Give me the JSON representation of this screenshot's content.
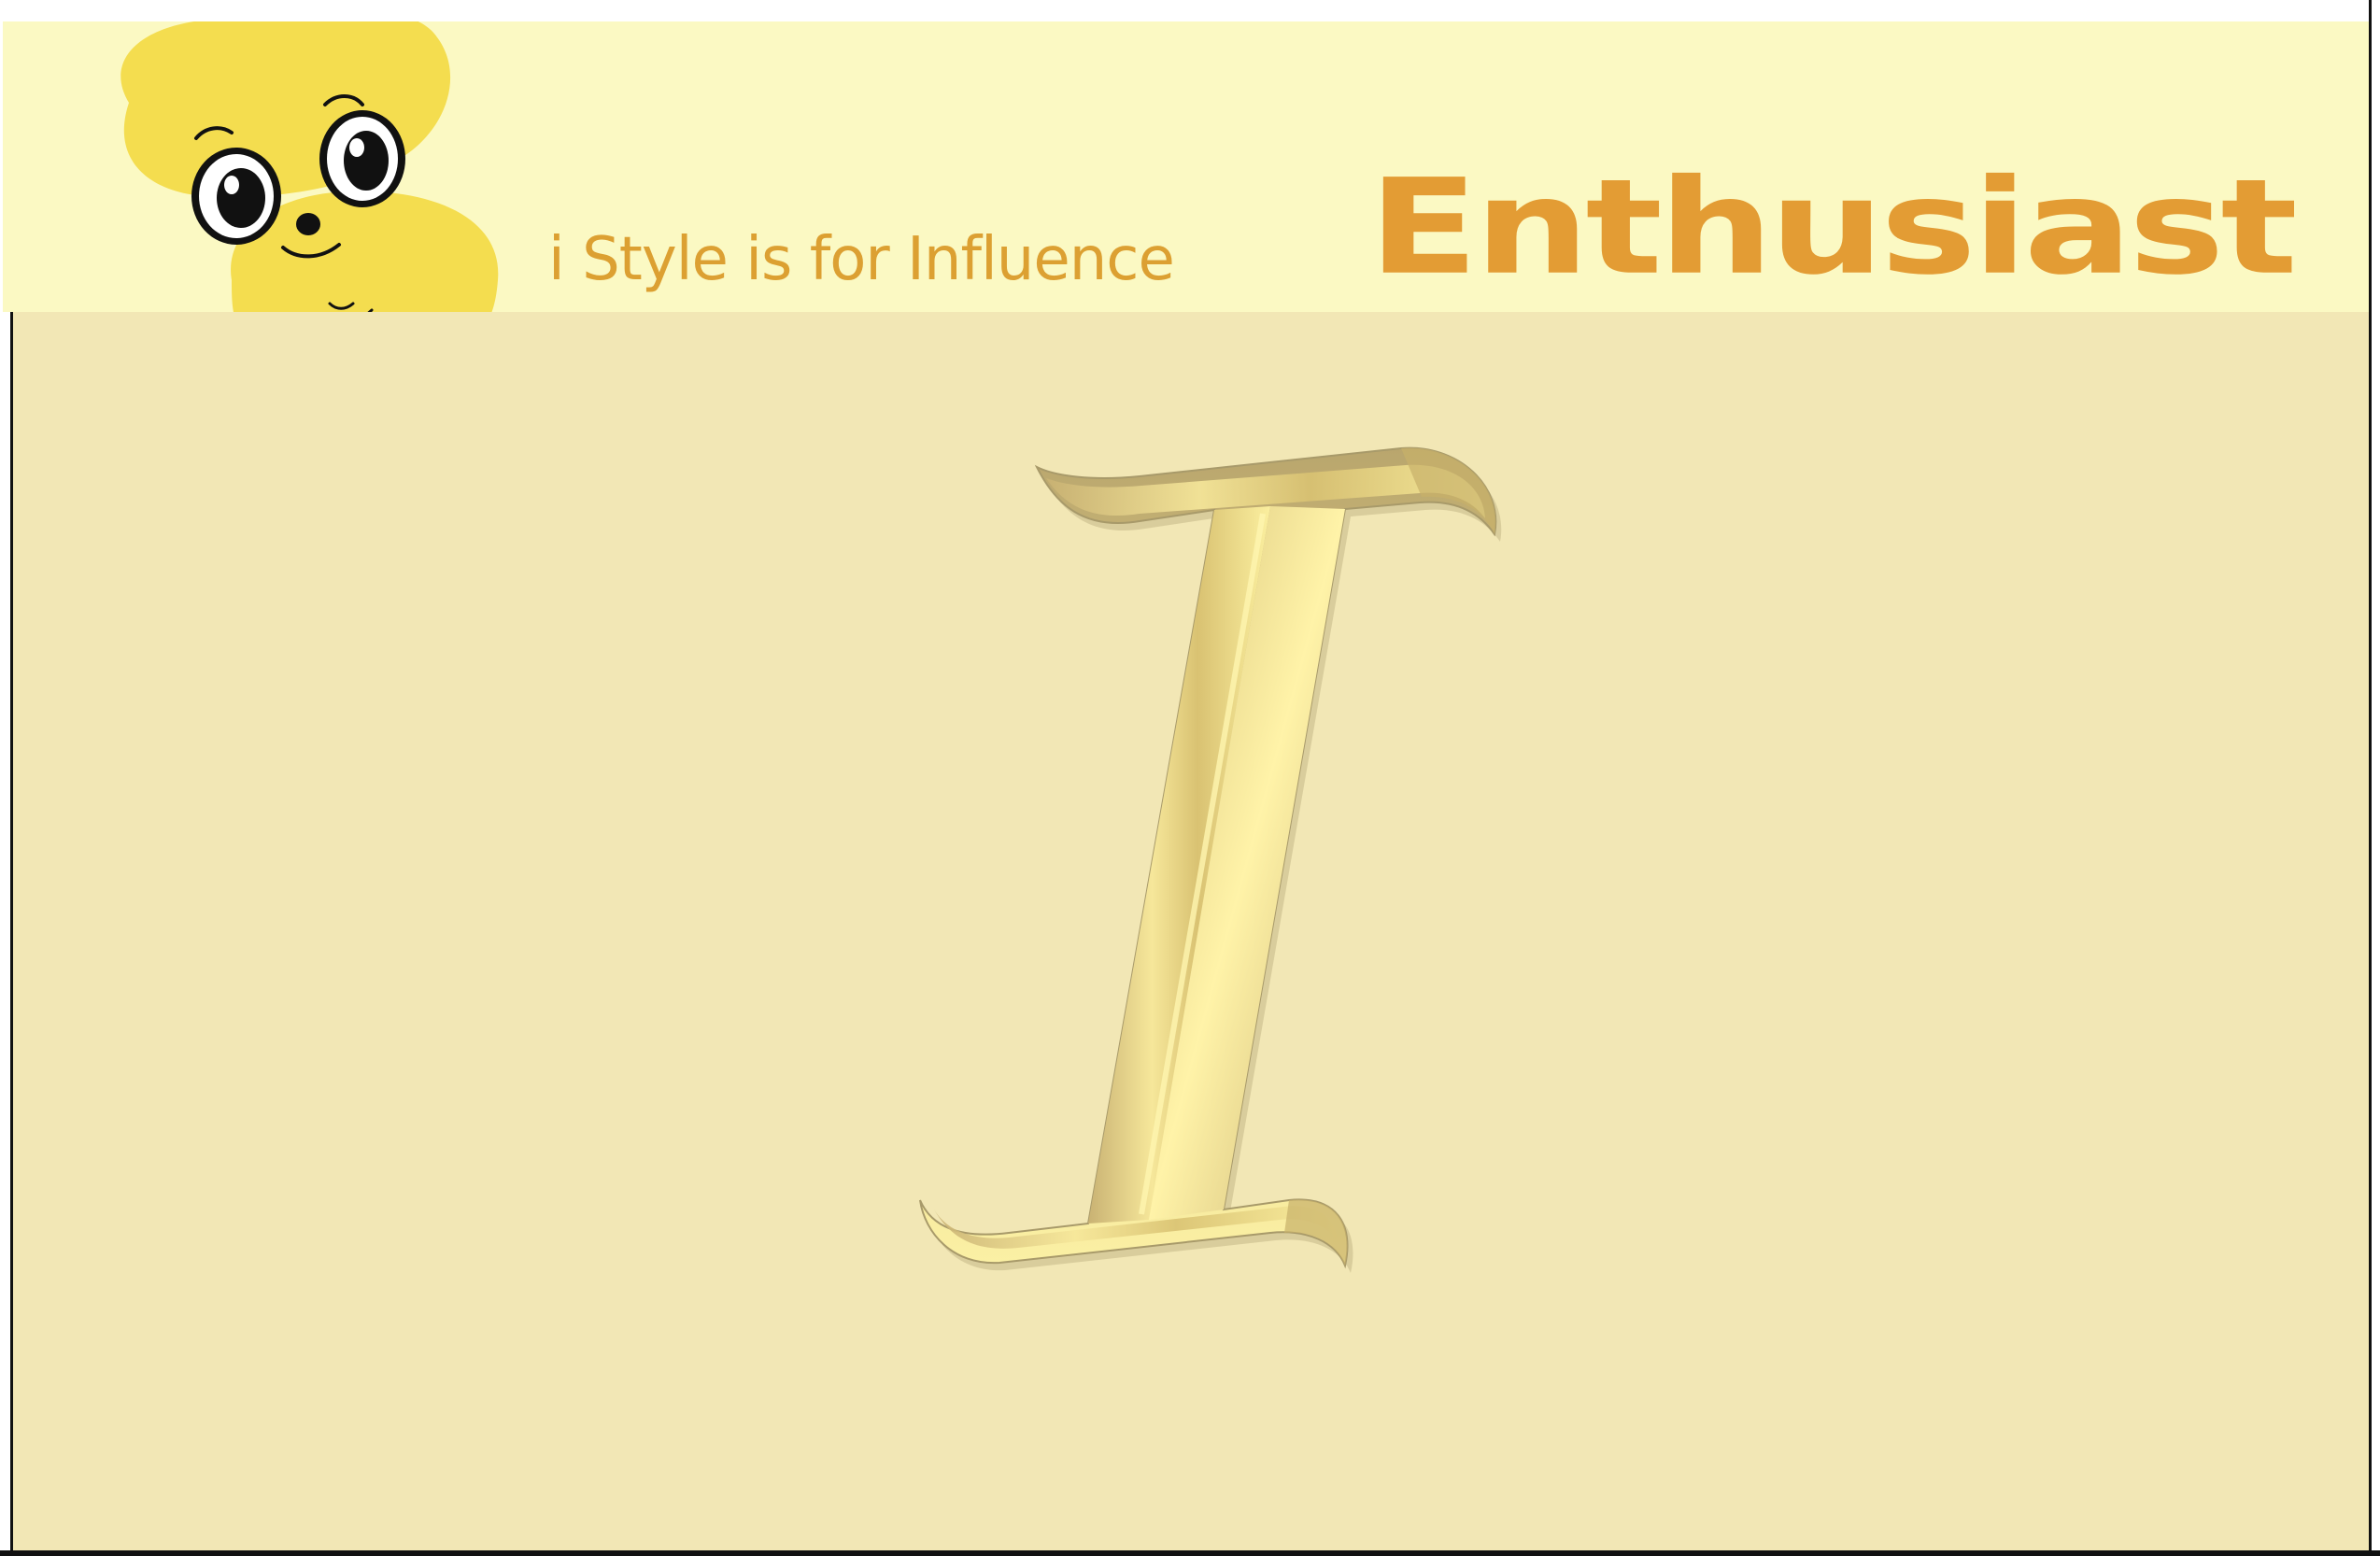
{
  "header": {
    "tagline": "i Style is for Influence",
    "brand": "Enthusiast"
  },
  "mascot": {
    "icon": "yellow-blob-mascot-icon"
  },
  "main": {
    "letter": "I",
    "letter_style": "embossed-gold-italic"
  },
  "colors": {
    "banner_bg": "#fbf9c3",
    "canvas_bg": "#f2e7b5",
    "brand_text": "#e39c34",
    "tagline_text": "#dca032",
    "mascot_fill": "#f4dd4f"
  }
}
